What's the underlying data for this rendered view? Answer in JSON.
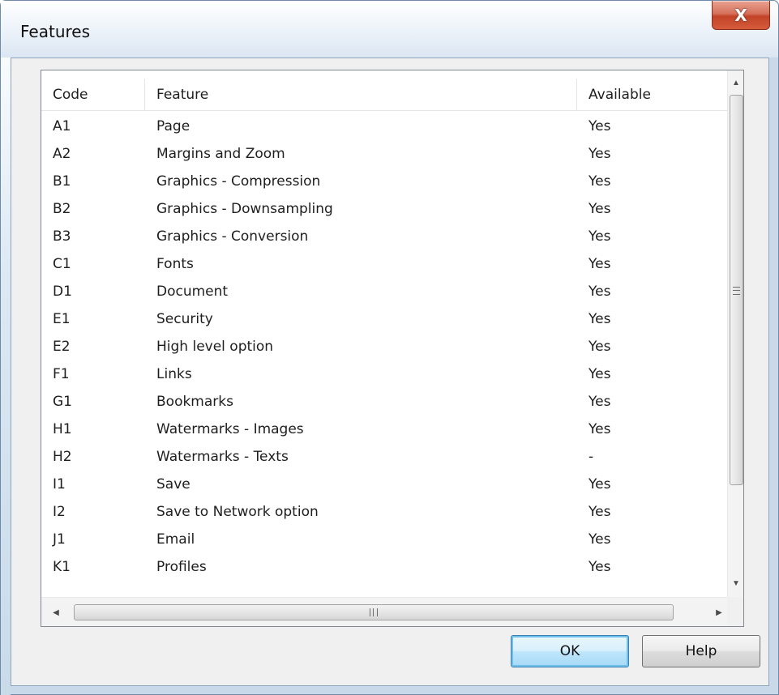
{
  "window": {
    "title": "Features",
    "close_glyph": "X"
  },
  "table": {
    "columns": [
      "Code",
      "Feature",
      "Available"
    ],
    "rows": [
      {
        "code": "A1",
        "feature": "Page",
        "available": "Yes"
      },
      {
        "code": "A2",
        "feature": "Margins and Zoom",
        "available": "Yes"
      },
      {
        "code": "B1",
        "feature": "Graphics - Compression",
        "available": "Yes"
      },
      {
        "code": "B2",
        "feature": "Graphics - Downsampling",
        "available": "Yes"
      },
      {
        "code": "B3",
        "feature": "Graphics - Conversion",
        "available": "Yes"
      },
      {
        "code": "C1",
        "feature": "Fonts",
        "available": "Yes"
      },
      {
        "code": "D1",
        "feature": "Document",
        "available": "Yes"
      },
      {
        "code": "E1",
        "feature": "Security",
        "available": "Yes"
      },
      {
        "code": "E2",
        "feature": "High level option",
        "available": "Yes"
      },
      {
        "code": "F1",
        "feature": "Links",
        "available": "Yes"
      },
      {
        "code": "G1",
        "feature": "Bookmarks",
        "available": "Yes"
      },
      {
        "code": "H1",
        "feature": "Watermarks - Images",
        "available": "Yes"
      },
      {
        "code": "H2",
        "feature": "Watermarks - Texts",
        "available": "-"
      },
      {
        "code": "I1",
        "feature": "Save",
        "available": "Yes"
      },
      {
        "code": "I2",
        "feature": "Save to Network option",
        "available": "Yes"
      },
      {
        "code": "J1",
        "feature": "Email",
        "available": "Yes"
      },
      {
        "code": "K1",
        "feature": "Profiles",
        "available": "Yes"
      }
    ]
  },
  "buttons": {
    "ok_label": "OK",
    "help_label": "Help"
  },
  "icons": {
    "close": "close-icon",
    "scroll_up": "arrow-up-icon",
    "scroll_down": "arrow-down-icon",
    "scroll_left": "arrow-left-icon",
    "scroll_right": "arrow-right-icon"
  },
  "colors": {
    "default_button_border": "#3c7fb1",
    "close_button": "#c24428"
  }
}
